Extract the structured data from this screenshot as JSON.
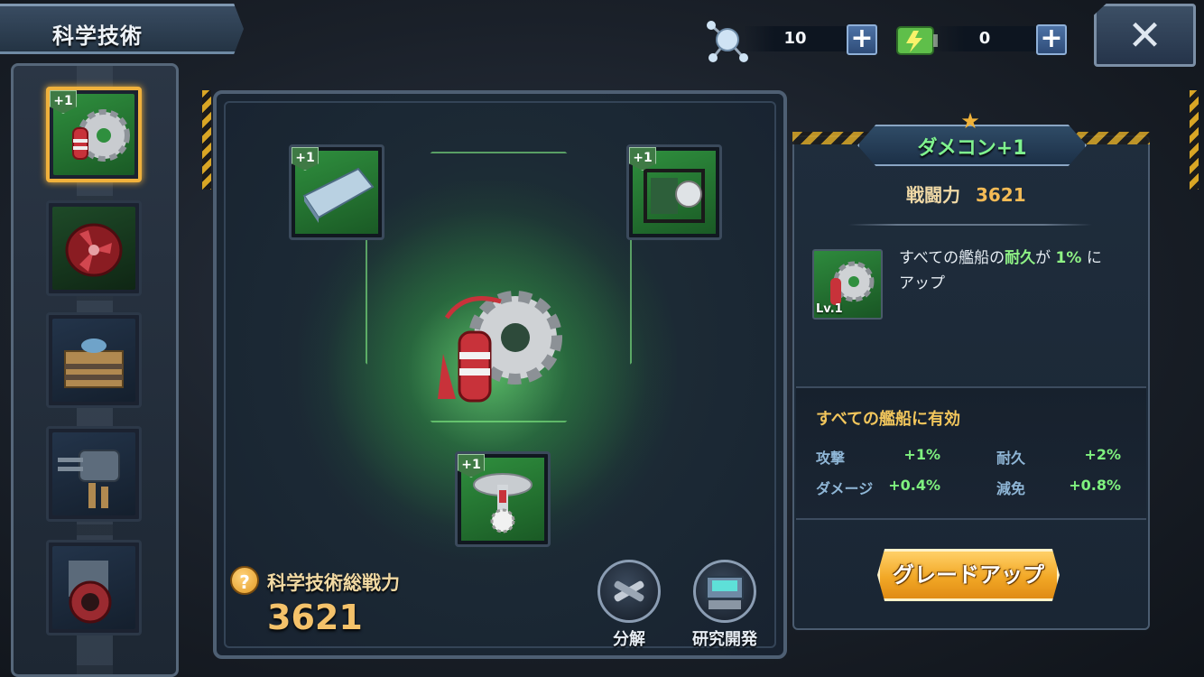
{
  "header": {
    "title": "科学技術"
  },
  "resources": [
    {
      "name": "crystal",
      "icon": "molecule-icon",
      "value": "10"
    },
    {
      "name": "energy",
      "icon": "battery-icon",
      "value": "0"
    }
  ],
  "sidebar": {
    "items": [
      {
        "name": "damage-control",
        "icon": "extinguisher-gear-icon",
        "plus": "+1",
        "selected": true
      },
      {
        "name": "propeller",
        "icon": "propeller-icon",
        "plus": ""
      },
      {
        "name": "armor-block",
        "icon": "armor-block-icon",
        "plus": ""
      },
      {
        "name": "turret",
        "icon": "turret-icon",
        "plus": ""
      },
      {
        "name": "engine",
        "icon": "engine-icon",
        "plus": ""
      }
    ]
  },
  "center": {
    "nodes": [
      {
        "name": "hull-plate",
        "icon": "hull-plate-icon",
        "plus": "+1"
      },
      {
        "name": "pump",
        "icon": "water-pump-icon",
        "plus": "+1"
      },
      {
        "name": "sprinkler",
        "icon": "sprinkler-icon",
        "plus": "+1"
      }
    ],
    "total_power_label": "科学技術総戦力",
    "total_power_value": "3621",
    "actions": [
      {
        "label": "分解",
        "icon": "disassemble-icon"
      },
      {
        "label": "研究開発",
        "icon": "research-lab-icon"
      }
    ]
  },
  "info": {
    "title": "ダメコン+1",
    "power_label": "戦闘力",
    "power_value": "3621",
    "level": "Lv.1",
    "desc_prefix": "すべての艦船の",
    "desc_stat": "耐久",
    "desc_mid": "が",
    "desc_value": "1%",
    "desc_suffix": "に",
    "desc_line2": "アップ",
    "bonus_title": "すべての艦船に有効",
    "bonuses": [
      {
        "name": "攻撃",
        "value": "+1%"
      },
      {
        "name": "耐久",
        "value": "+2%"
      },
      {
        "name": "ダメージ",
        "value": "+0.4%"
      },
      {
        "name": "減免",
        "value": "+0.8%"
      }
    ],
    "upgrade_label": "グレードアップ"
  },
  "colors": {
    "accent_gold": "#f0b13c",
    "title_green": "#7ff38f",
    "stat_green": "#7ff27f",
    "upgrade_orange": "#f2a826"
  }
}
